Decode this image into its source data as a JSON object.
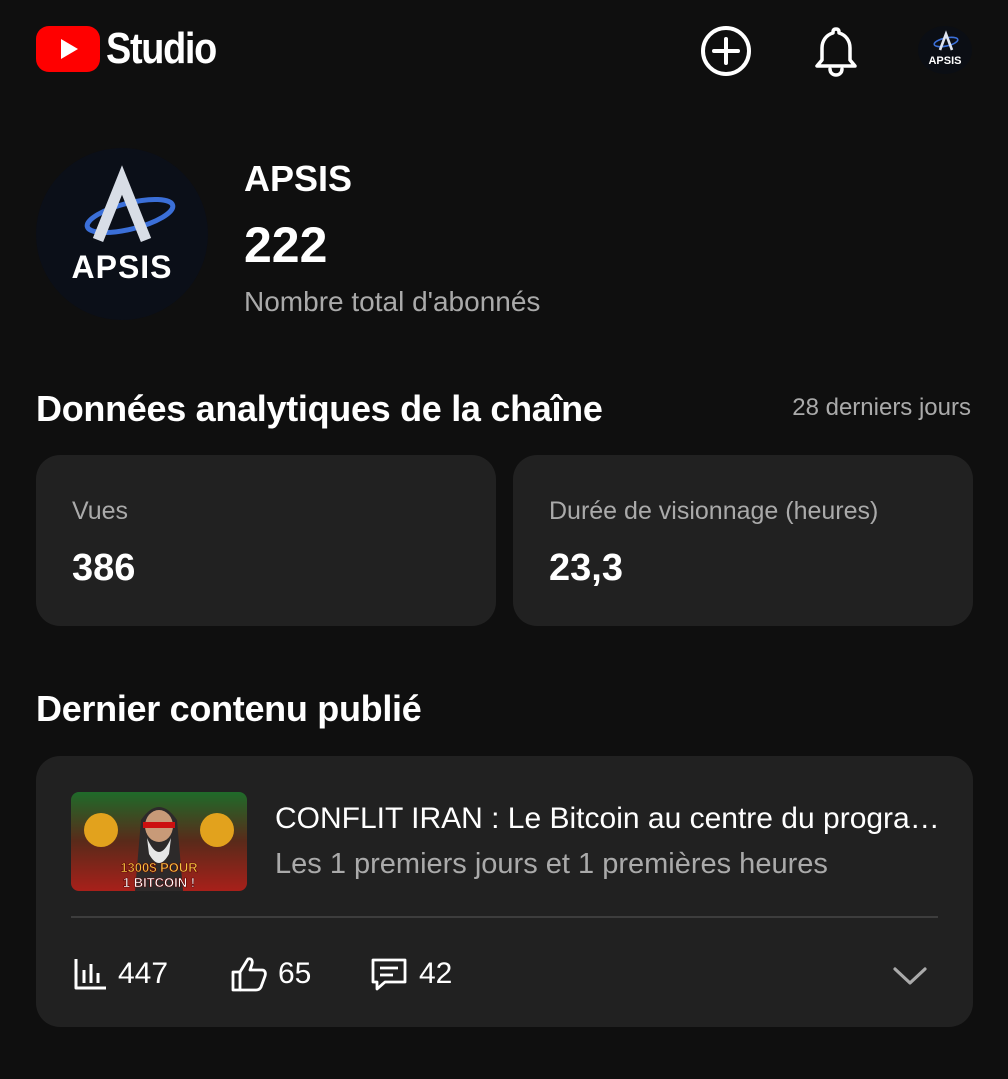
{
  "header": {
    "app_name": "Studio",
    "icons": {
      "logo": "youtube-play-icon",
      "create": "add-circle-icon",
      "notifications": "bell-icon",
      "account": "apsis-avatar-icon"
    },
    "account_avatar_text": "APSIS"
  },
  "channel": {
    "avatar_text": "APSIS",
    "name": "APSIS",
    "subscriber_count": "222",
    "subscriber_label": "Nombre total d'abonnés"
  },
  "analytics": {
    "title": "Données analytiques de la chaîne",
    "period": "28 derniers jours",
    "cards": [
      {
        "label": "Vues",
        "value": "386"
      },
      {
        "label": "Durée de visionnage (heures)",
        "value": "23,3"
      }
    ]
  },
  "latest": {
    "title": "Dernier contenu publié",
    "video": {
      "thumbnail_text": [
        "1300$ POUR",
        "1 BITCOIN !"
      ],
      "title": "CONFLIT IRAN : Le Bitcoin au centre du programme nucléaire iranien",
      "subtitle": "Les 1 premiers jours et 1 premières heures",
      "views": "447",
      "likes": "65",
      "comments": "42"
    }
  },
  "colors": {
    "background": "#0f0f0f",
    "card": "#212121",
    "brand_red": "#ff0000",
    "text_secondary": "#aaaaaa",
    "avatar_blue": "#3b6fd8"
  }
}
